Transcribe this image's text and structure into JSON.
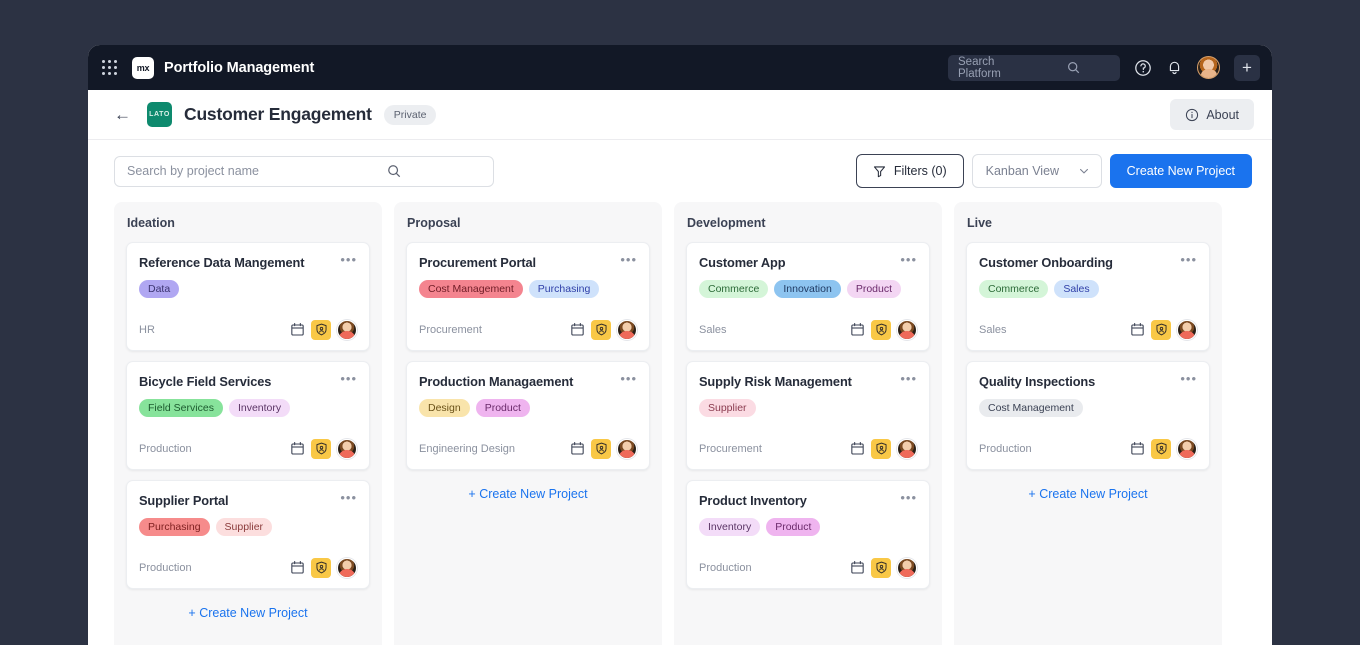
{
  "topbar": {
    "app_title": "Portfolio Management",
    "logo_text": "mx",
    "search": {
      "placeholder": "Search Platform",
      "value": ""
    },
    "icons": [
      "apps-grid-icon",
      "search-icon",
      "help-icon",
      "notifications-bell-icon",
      "user-avatar",
      "add-icon"
    ]
  },
  "pagehead": {
    "project_icon_text": "LATO",
    "title": "Customer Engagement",
    "visibility_badge": "Private",
    "about_label": "About"
  },
  "toolbar": {
    "search_placeholder": "Search by project name",
    "search_value": "",
    "filters_label": "Filters (0)",
    "view_label": "Kanban View",
    "create_label": "Create New Project"
  },
  "board": {
    "add_link_label": "+ Create New Project",
    "accent_color": "#1a73ee",
    "columns": [
      {
        "title": "Ideation",
        "show_add_link": true,
        "cards": [
          {
            "title": "Reference Data Mangement",
            "tags": [
              {
                "label": "Data",
                "bg": "#b0a7f2",
                "fg": "#3b3470"
              }
            ],
            "department": "HR"
          },
          {
            "title": "Bicycle Field Services",
            "tags": [
              {
                "label": "Field Services",
                "bg": "#87e39b",
                "fg": "#1d5b2f"
              },
              {
                "label": "Inventory",
                "bg": "#f3dcf8",
                "fg": "#5b3566"
              }
            ],
            "department": "Production"
          },
          {
            "title": "Supplier Portal",
            "tags": [
              {
                "label": "Purchasing",
                "bg": "#f68b8b",
                "fg": "#7d1f1f"
              },
              {
                "label": "Supplier",
                "bg": "#fcdede",
                "fg": "#8b3b3b"
              }
            ],
            "department": "Production"
          }
        ]
      },
      {
        "title": "Proposal",
        "show_add_link": true,
        "cards": [
          {
            "title": "Procurement Portal",
            "tags": [
              {
                "label": "Cost Management",
                "bg": "#f4848f",
                "fg": "#6f1c26"
              },
              {
                "label": "Purchasing",
                "bg": "#cfe2fb",
                "fg": "#2f3fa8"
              }
            ],
            "department": "Procurement"
          },
          {
            "title": "Production Managaement",
            "tags": [
              {
                "label": "Design",
                "bg": "#f9e4ab",
                "fg": "#6b5218"
              },
              {
                "label": "Product",
                "bg": "#efb4ef",
                "fg": "#6b2a6b"
              }
            ],
            "department": "Engineering Design"
          }
        ]
      },
      {
        "title": "Development",
        "show_add_link": false,
        "cards": [
          {
            "title": "Customer App",
            "tags": [
              {
                "label": "Commerce",
                "bg": "#d4f5d8",
                "fg": "#2c6b38"
              },
              {
                "label": "Innovation",
                "bg": "#8dc4f0",
                "fg": "#1f3a63"
              },
              {
                "label": "Product",
                "bg": "#f3d6f3",
                "fg": "#6b2a6b"
              }
            ],
            "department": "Sales"
          },
          {
            "title": "Supply Risk Management",
            "tags": [
              {
                "label": "Supplier",
                "bg": "#fbdbe3",
                "fg": "#8b3b4f"
              }
            ],
            "department": "Procurement"
          },
          {
            "title": "Product Inventory",
            "tags": [
              {
                "label": "Inventory",
                "bg": "#f3dcf8",
                "fg": "#5b3566"
              },
              {
                "label": "Product",
                "bg": "#efb4ef",
                "fg": "#6b2a6b"
              }
            ],
            "department": "Production"
          }
        ]
      },
      {
        "title": "Live",
        "show_add_link": true,
        "cards": [
          {
            "title": "Customer Onboarding",
            "tags": [
              {
                "label": "Commerce",
                "bg": "#d4f5d8",
                "fg": "#2c6b38"
              },
              {
                "label": "Sales",
                "bg": "#cfe2fb",
                "fg": "#2f3fa8"
              }
            ],
            "department": "Sales"
          },
          {
            "title": "Quality Inspections",
            "tags": [
              {
                "label": "Cost Management",
                "bg": "#e9ebee",
                "fg": "#3b4254"
              }
            ],
            "department": "Production"
          }
        ]
      }
    ]
  }
}
